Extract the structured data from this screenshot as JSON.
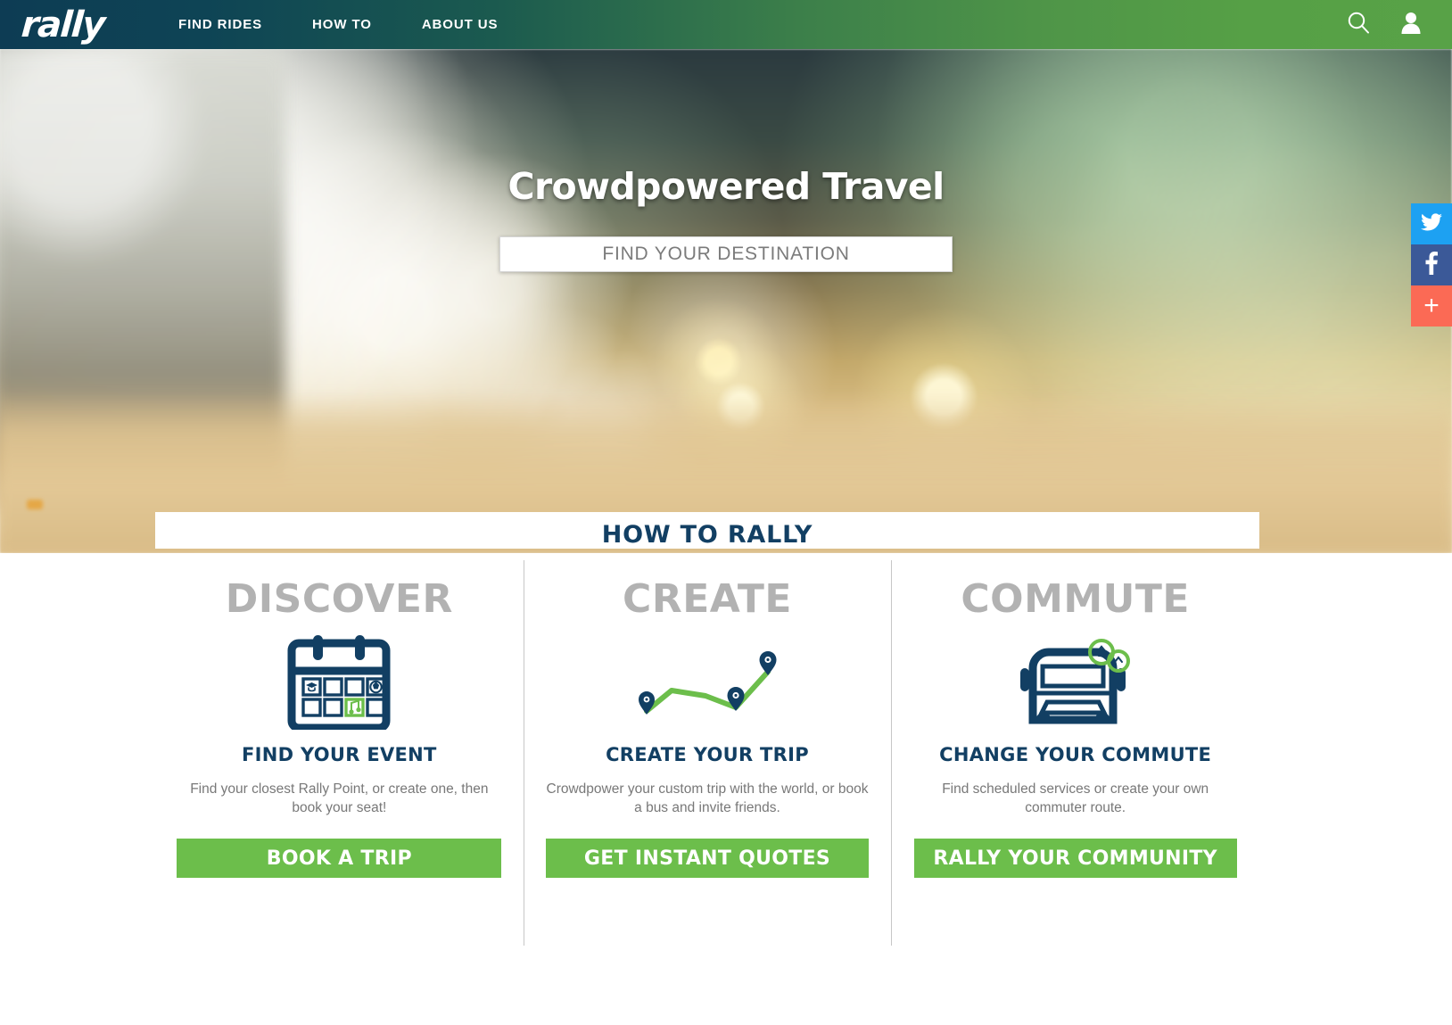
{
  "header": {
    "brand": "rally",
    "nav": [
      {
        "label": "FIND RIDES"
      },
      {
        "label": "HOW TO"
      },
      {
        "label": "ABOUT US"
      }
    ],
    "icons": {
      "search": "search-icon",
      "account": "user-icon"
    },
    "colors": {
      "gradient_start": "#0d3c54",
      "gradient_end": "#58a247"
    }
  },
  "hero": {
    "title": "Crowdpowered Travel",
    "search_placeholder": "FIND YOUR DESTINATION",
    "search_value": ""
  },
  "social": [
    {
      "name": "twitter-share-button",
      "glyph": "twitter",
      "color": "#1da1f2"
    },
    {
      "name": "facebook-share-button",
      "glyph": "facebook",
      "color": "#3b5998"
    },
    {
      "name": "more-share-button",
      "glyph": "+",
      "color": "#fb6a55"
    }
  ],
  "how_to": {
    "section_title": "HOW TO RALLY",
    "title_color": "#123f63",
    "button_color": "#6cbe4b",
    "columns": [
      {
        "kicker": "DISCOVER",
        "icon": "calendar-icon",
        "heading": "FIND YOUR EVENT",
        "description": "Find your closest Rally Point, or create one, then book your seat!",
        "button_label": "BOOK A TRIP"
      },
      {
        "kicker": "CREATE",
        "icon": "route-map-pins-icon",
        "heading": "CREATE YOUR TRIP",
        "description": "Crowdpower your custom trip with the world, or book a bus and invite friends.",
        "button_label": "GET INSTANT QUOTES"
      },
      {
        "kicker": "COMMUTE",
        "icon": "bus-icon",
        "heading": "CHANGE YOUR COMMUTE",
        "description": "Find scheduled services or create your own commuter route.",
        "button_label": "RALLY YOUR COMMUNITY"
      }
    ]
  }
}
